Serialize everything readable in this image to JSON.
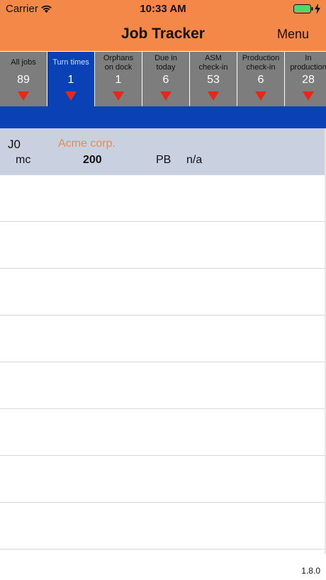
{
  "status_bar": {
    "carrier": "Carrier",
    "time": "10:33 AM"
  },
  "header": {
    "title": "Job Tracker",
    "menu_label": "Menu",
    "background": "#f38848"
  },
  "tabs": [
    {
      "label": "All jobs",
      "count": "89",
      "active": false
    },
    {
      "label": "Turn times",
      "count": "1",
      "active": true
    },
    {
      "label": "Orphans\non dock",
      "count": "1",
      "active": false
    },
    {
      "label": "Due in\ntoday",
      "count": "6",
      "active": false
    },
    {
      "label": "ASM\ncheck-in",
      "count": "53",
      "active": false
    },
    {
      "label": "Production\ncheck-in",
      "count": "6",
      "active": false
    },
    {
      "label": "In\nproduction",
      "count": "28",
      "active": false
    }
  ],
  "job": {
    "id": "J0",
    "customer": "Acme corp.",
    "unit": "mc",
    "quantity": "200",
    "code": "PB",
    "status": "n/a"
  },
  "footer": {
    "version": "1.8.0"
  },
  "colors": {
    "accent": "#f38848",
    "active_tab": "#0a41b5",
    "tab": "#7d7d7d",
    "card": "#c9d1e1",
    "indicator": "#e8271b"
  }
}
